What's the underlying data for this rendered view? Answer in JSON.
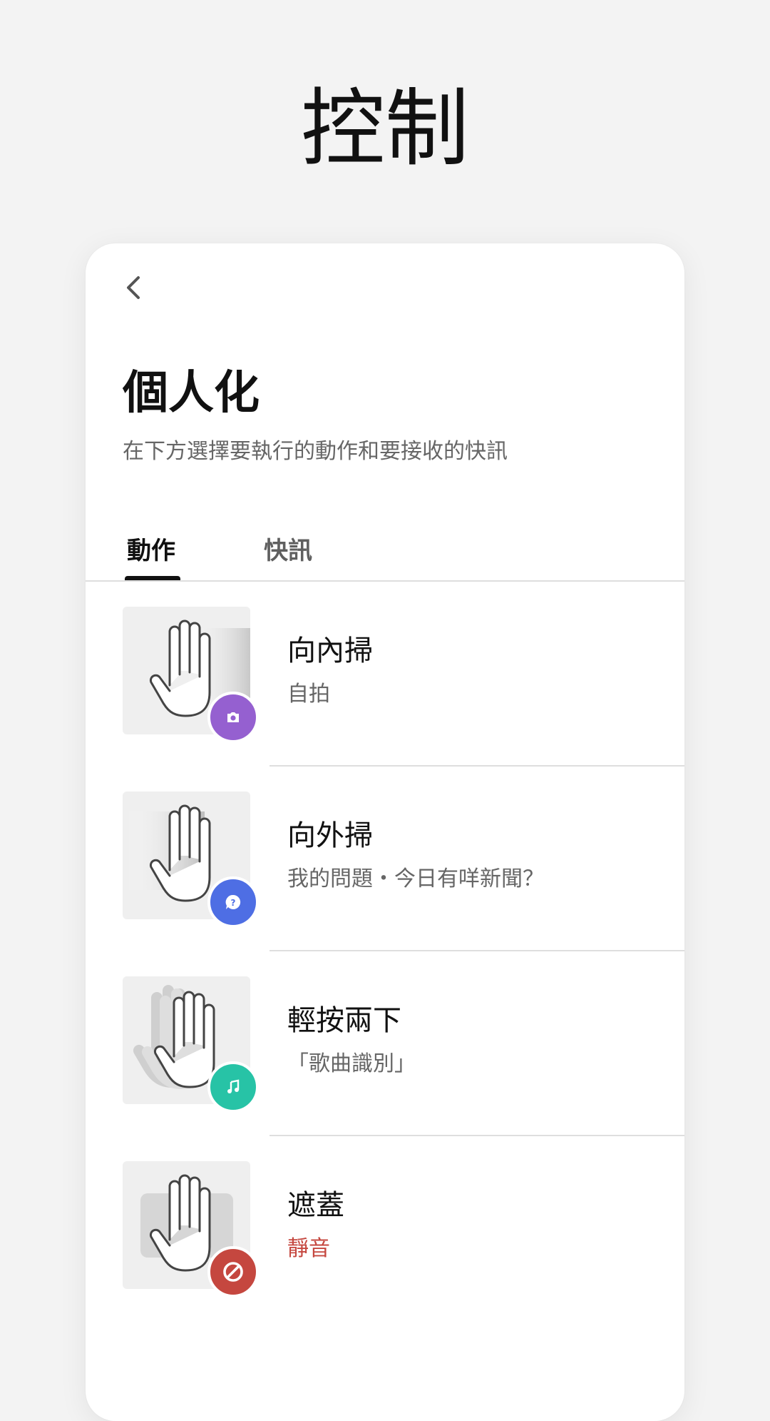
{
  "hero": {
    "title": "控制"
  },
  "card": {
    "title": "個人化",
    "subtitle": "在下方選擇要執行的動作和要接收的快訊",
    "tabs": [
      {
        "label": "動作",
        "selected": true
      },
      {
        "label": "快訊",
        "selected": false
      }
    ],
    "items": [
      {
        "title": "向內掃",
        "subtitle": "自拍",
        "badge_icon": "camera-icon",
        "badge_color": "#9560d0"
      },
      {
        "title": "向外掃",
        "subtitle": "我的問題・今日有咩新聞？",
        "badge_icon": "assistant-question-icon",
        "badge_color": "#4e6ee4"
      },
      {
        "title": "輕按兩下",
        "subtitle": "「歌曲識別」",
        "badge_icon": "music-note-icon",
        "badge_color": "#27c3a6"
      },
      {
        "title": "遮蓋",
        "subtitle": "靜音",
        "subtitle_color": "#c5473f",
        "badge_icon": "mute-block-icon",
        "badge_color": "#c5473f"
      }
    ]
  }
}
